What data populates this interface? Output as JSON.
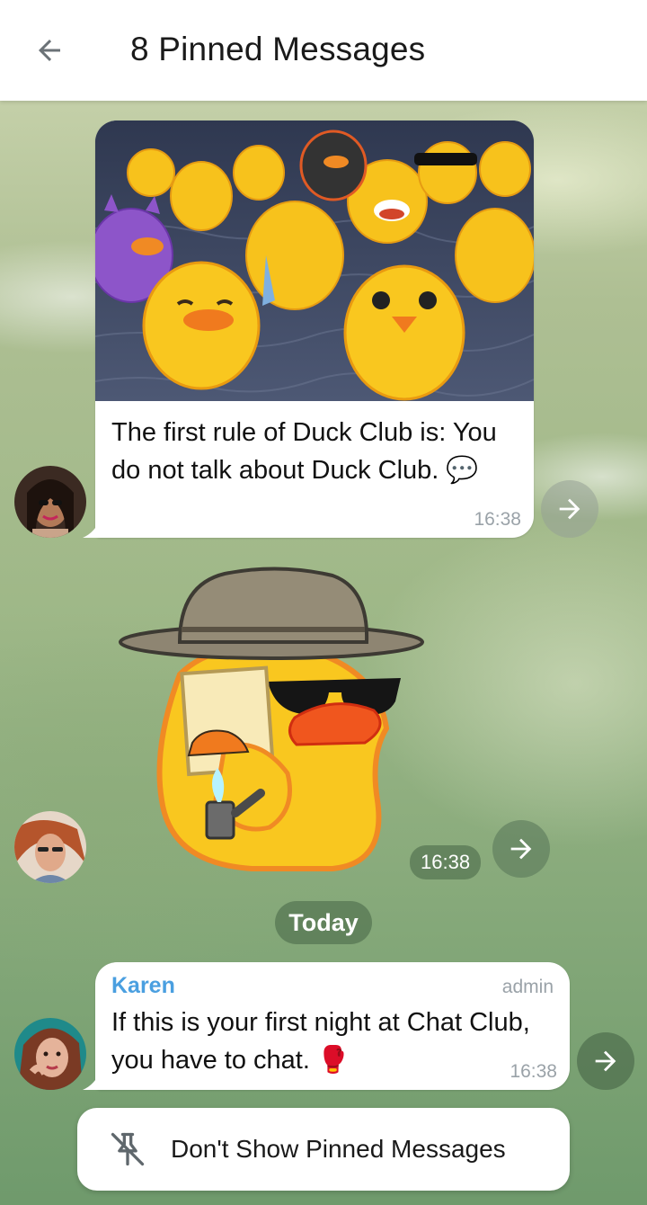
{
  "header": {
    "title": "8 Pinned Messages",
    "back_icon": "arrow-left-icon"
  },
  "messages": [
    {
      "text": "The first rule of Duck Club is: You do not talk about Duck Club. 💬",
      "time": "16:38",
      "media": "duck-club-image"
    },
    {
      "sticker": "duck-detective-sticker",
      "time": "16:38"
    },
    {
      "sender": "Karen",
      "role": "admin",
      "text": "If this is your first night at Chat Club, you have to chat. 🥊",
      "time": "16:38"
    }
  ],
  "date_separator": "Today",
  "footer": {
    "unpin_label": "Don't Show Pinned Messages",
    "unpin_icon": "unpin-icon"
  },
  "colors": {
    "accent": "#4a9fe0",
    "header_bg": "#ffffff",
    "bubble_bg": "#ffffff"
  }
}
